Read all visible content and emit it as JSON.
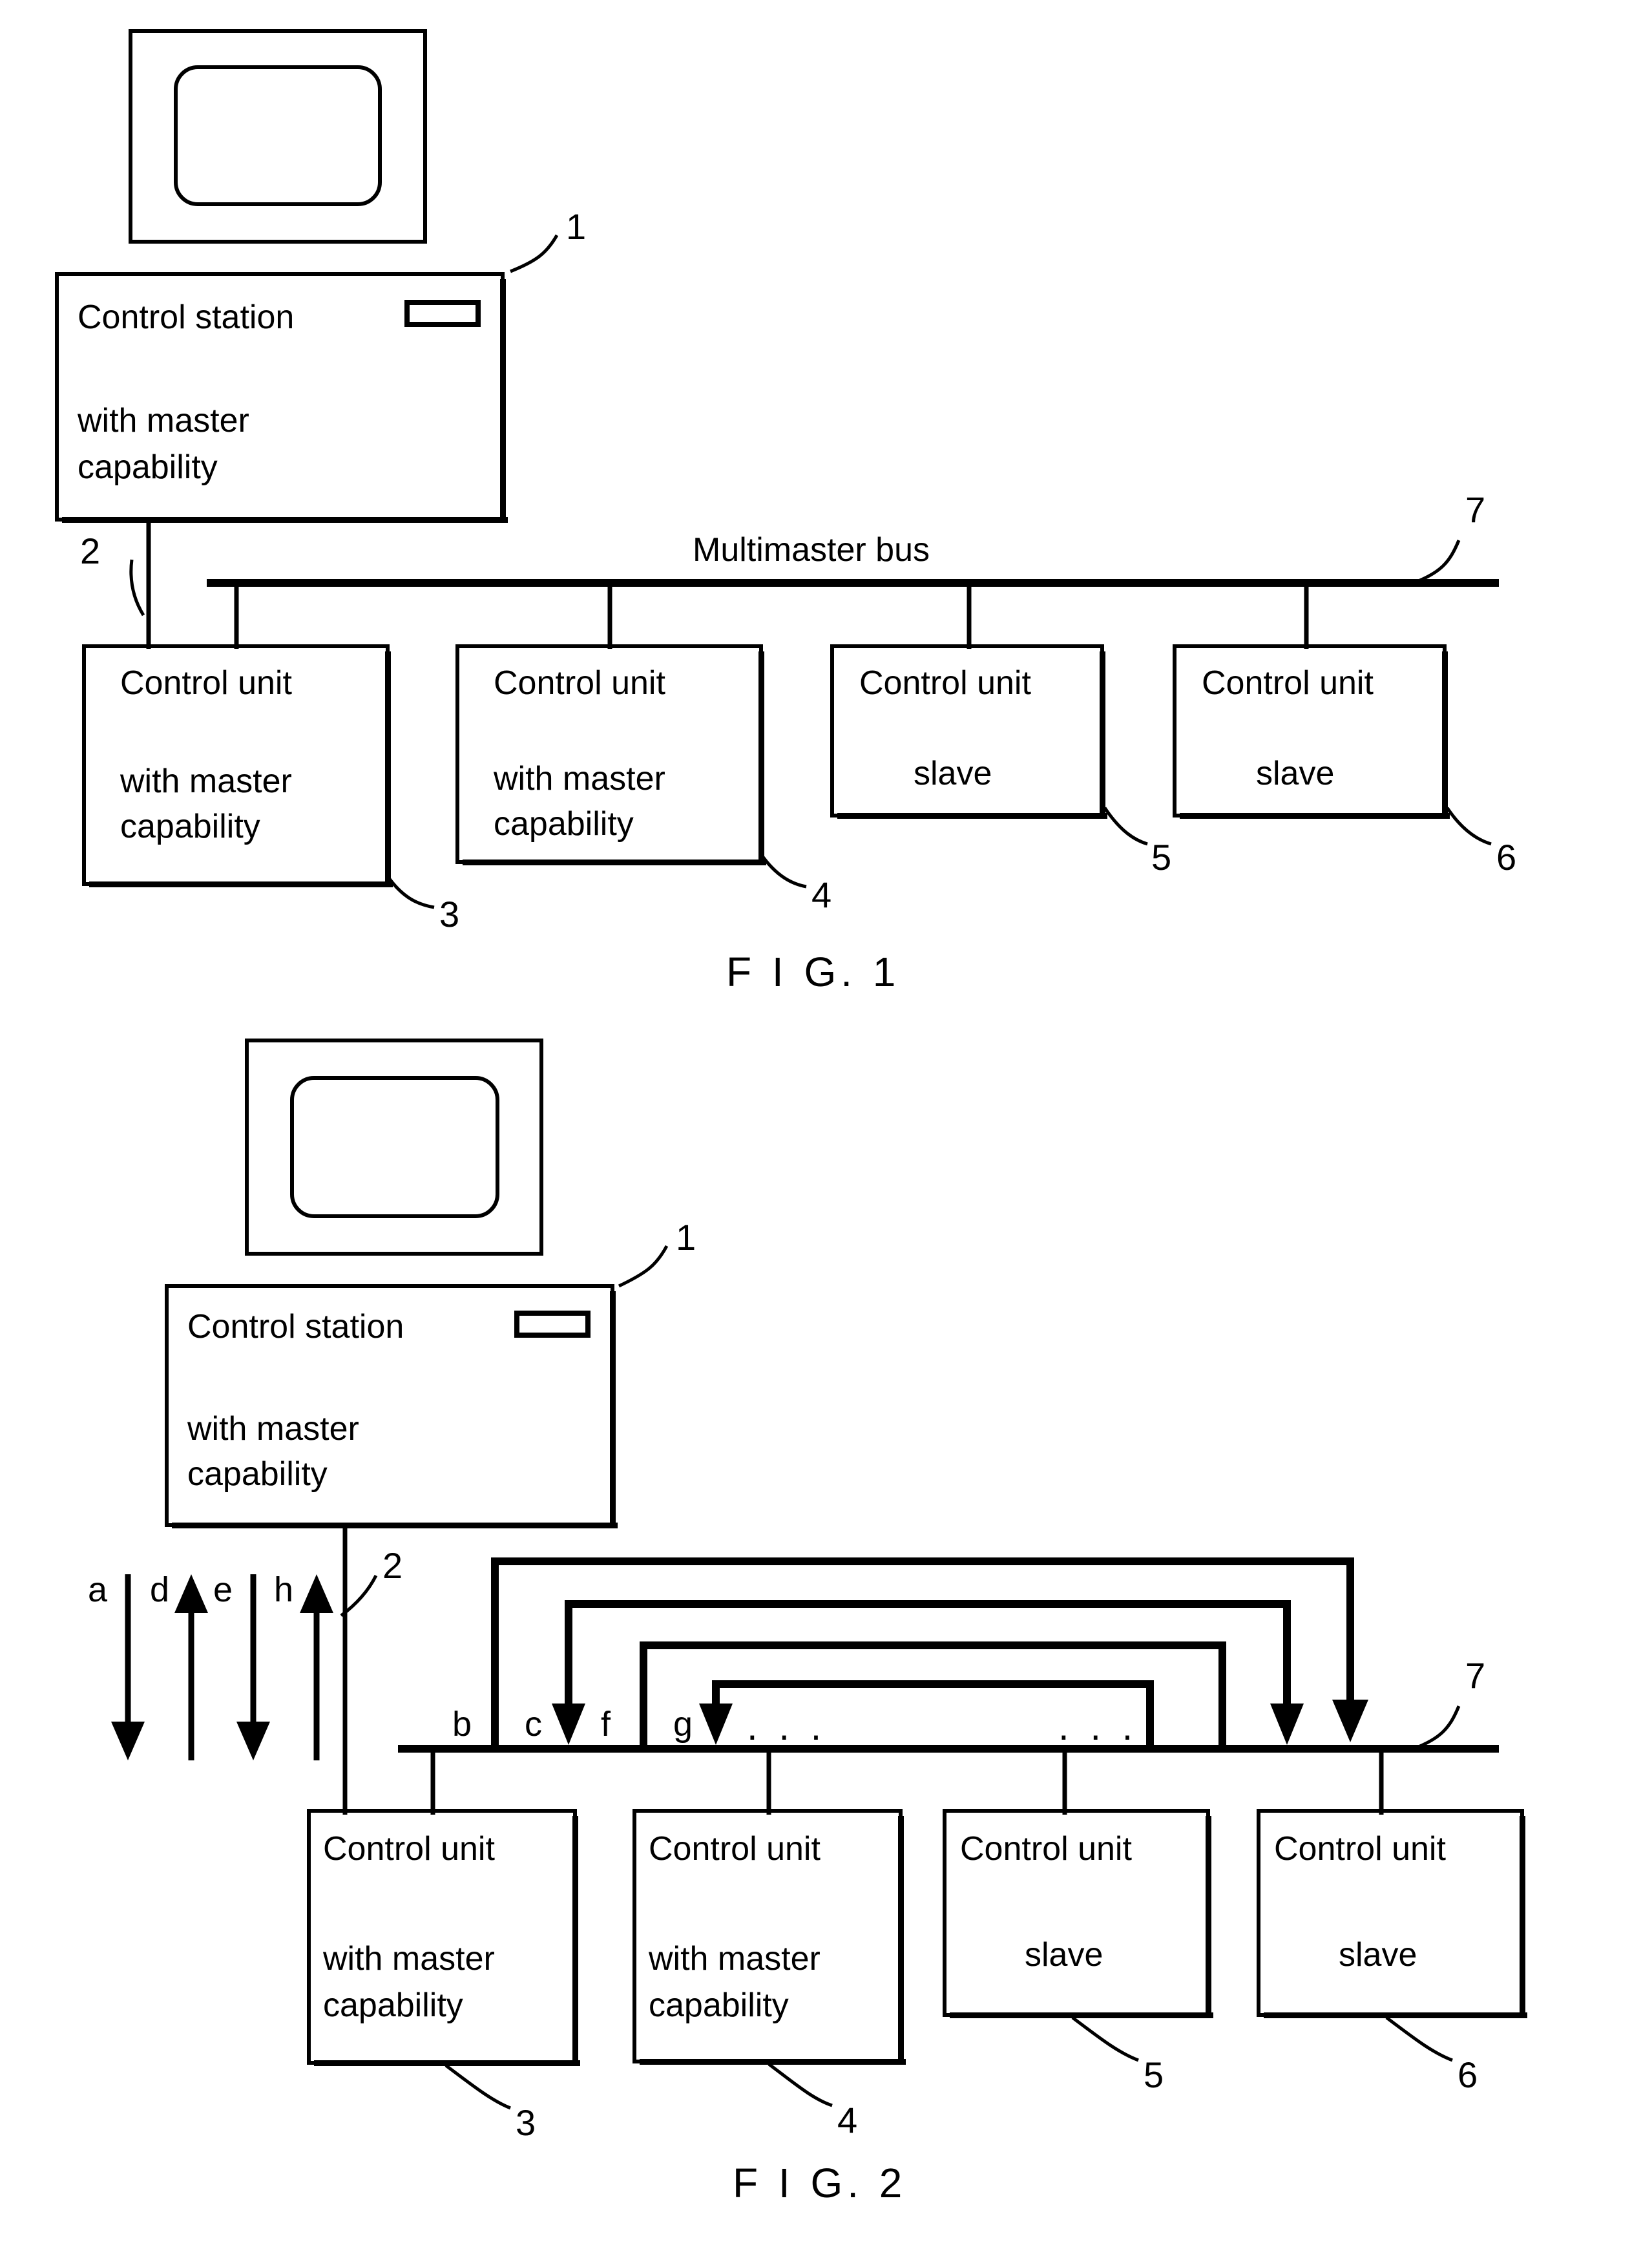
{
  "sheet": {
    "title": "Patent drawing sheet with FIG. 1 and FIG. 2",
    "background_color": "#ffffff",
    "ink_color": "#000000"
  },
  "figure1": {
    "caption": "F I G. 1",
    "monitor": {
      "name": "crt-monitor"
    },
    "control_station": {
      "title": "Control station",
      "line1": "with master",
      "line2": "capability",
      "ref": "1",
      "slot_icon": "disk-slot-icon"
    },
    "bus": {
      "label": "Multimaster bus",
      "ref": "7",
      "drop_ref": "2"
    },
    "units": [
      {
        "title": "Control unit",
        "line1": "with master",
        "line2": "capability",
        "ref": "3",
        "role": "master"
      },
      {
        "title": "Control unit",
        "line1": "with master",
        "line2": "capability",
        "ref": "4",
        "role": "master"
      },
      {
        "title": "Control unit",
        "line1": "slave",
        "line2": "",
        "ref": "5",
        "role": "slave"
      },
      {
        "title": "Control unit",
        "line1": "slave",
        "line2": "",
        "ref": "6",
        "role": "slave"
      }
    ]
  },
  "figure2": {
    "caption": "F I G. 2",
    "monitor": {
      "name": "crt-monitor"
    },
    "control_station": {
      "title": "Control station",
      "line1": "with master",
      "line2": "capability",
      "ref": "1",
      "slot_icon": "disk-slot-icon"
    },
    "bus": {
      "ref": "7",
      "drop_ref": "2"
    },
    "units": [
      {
        "title": "Control unit",
        "line1": "with master",
        "line2": "capability",
        "ref": "3",
        "role": "master"
      },
      {
        "title": "Control unit",
        "line1": "with master",
        "line2": "capability",
        "ref": "4",
        "role": "master"
      },
      {
        "title": "Control unit",
        "line1": "slave",
        "line2": "",
        "ref": "5",
        "role": "slave"
      },
      {
        "title": "Control unit",
        "line1": "slave",
        "line2": "",
        "ref": "6",
        "role": "slave"
      }
    ],
    "left_flows": [
      {
        "letter": "a",
        "direction": "down"
      },
      {
        "letter": "d",
        "direction": "up"
      },
      {
        "letter": "e",
        "direction": "down"
      },
      {
        "letter": "h",
        "direction": "up"
      }
    ],
    "bracket_flows": [
      {
        "letter": "b",
        "direction": "down"
      },
      {
        "letter": "c",
        "direction": "down"
      },
      {
        "letter": "f",
        "direction": "down"
      },
      {
        "letter": "g",
        "direction": "down"
      }
    ],
    "ellipsis_left": ". . .",
    "ellipsis_right": ". . ."
  }
}
